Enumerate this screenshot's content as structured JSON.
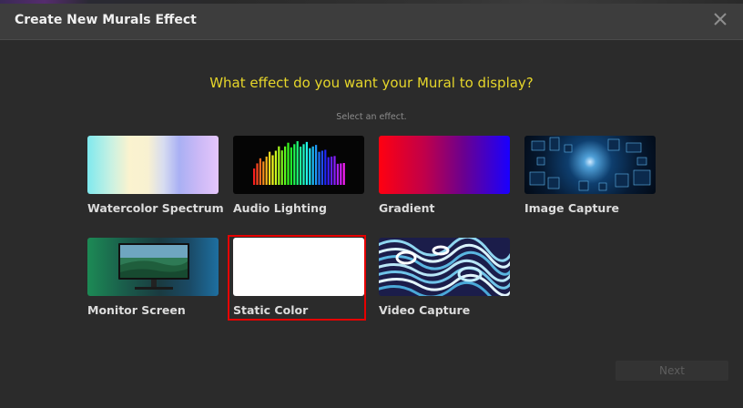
{
  "dialog": {
    "title": "Create New Murals Effect",
    "question": "What effect do you want your Mural to display?",
    "hint": "Select an effect.",
    "next_label": "Next"
  },
  "effects": [
    {
      "label": "Watercolor Spectrum"
    },
    {
      "label": "Audio Lighting"
    },
    {
      "label": "Gradient"
    },
    {
      "label": "Image Capture"
    },
    {
      "label": "Monitor Screen"
    },
    {
      "label": "Static Color",
      "selected": true
    },
    {
      "label": "Video Capture"
    }
  ],
  "colors": {
    "accent_question": "#e6d62a",
    "selection_border": "#e60000"
  }
}
